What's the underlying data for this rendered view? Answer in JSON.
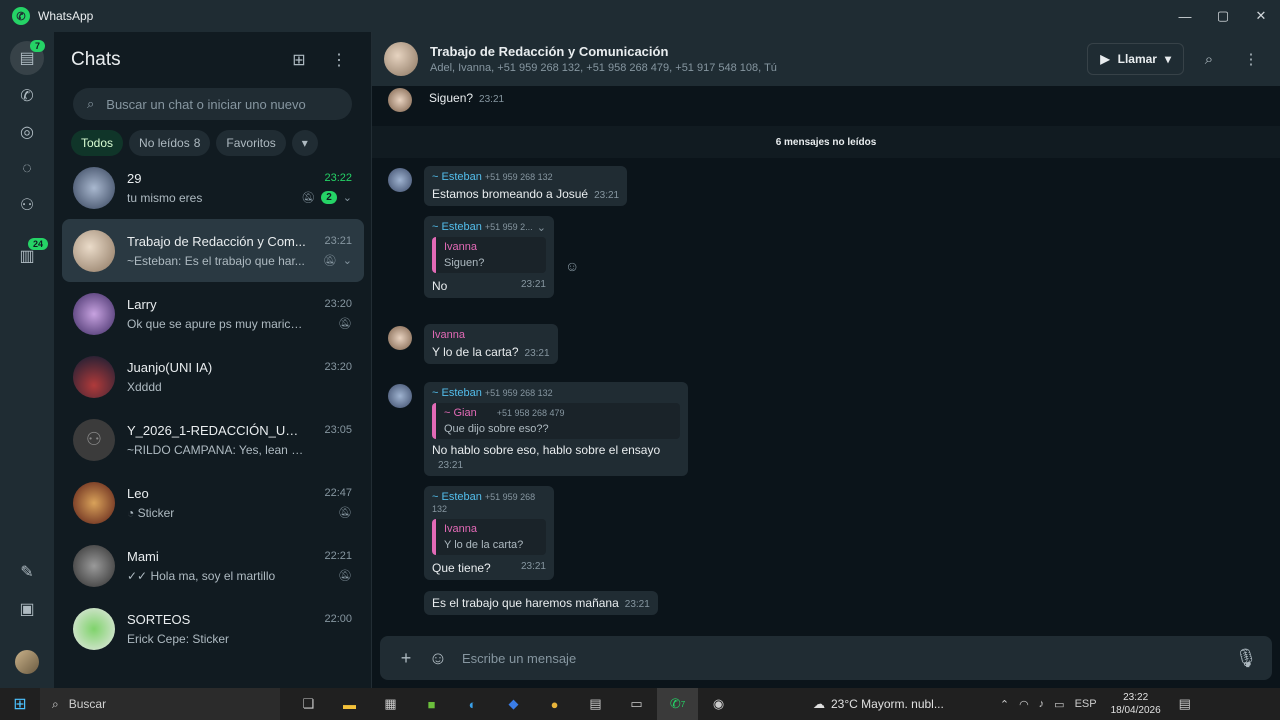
{
  "window": {
    "title": "WhatsApp",
    "controls": [
      "minimize",
      "maximize",
      "close"
    ]
  },
  "rail": {
    "chats_badge": "7",
    "status_badge": "24"
  },
  "sidebar": {
    "title": "Chats",
    "search_placeholder": "Buscar un chat o iniciar uno nuevo",
    "filters": [
      {
        "label": "Todos",
        "active": true
      },
      {
        "label": "No leídos",
        "count": "8"
      },
      {
        "label": "Favoritos"
      }
    ],
    "chats": [
      {
        "name": "29",
        "time": "23:22",
        "preview": "tu mismo eres",
        "unread": "2",
        "muted": true,
        "avatar_color": "#5a6f8a"
      },
      {
        "name": "Trabajo de Redacción y Com...",
        "time": "23:21",
        "preview": "~Esteban: Es el trabajo que har...",
        "muted": true,
        "selected": true,
        "avatar_color": "#c7b2a0"
      },
      {
        "name": "Larry",
        "time": "23:20",
        "preview": "Ok que se apure ps muy maricocin ...",
        "muted": true,
        "avatar_color": "#7a5fa8"
      },
      {
        "name": "Juanjo(UNI IA)",
        "time": "23:20",
        "preview": "Xdddd",
        "avatar_color": "#22344f"
      },
      {
        "name": "Y_2026_1-REDACCIÓN_UNI_...",
        "time": "23:05",
        "preview": "~RILDO CAMPANA: Yes, lean con aten...",
        "avatar_color": "#3b3b3b"
      },
      {
        "name": "Leo",
        "time": "22:47",
        "preview": "Sticker",
        "muted": true,
        "avatar_color": "#8c2f25"
      },
      {
        "name": "Mami",
        "time": "22:21",
        "preview": "Hola ma, soy el martillo",
        "muted": true,
        "avatar_color": "#555555"
      },
      {
        "name": "SORTEOS",
        "time": "22:00",
        "preview": "Erick Cepe: Sticker",
        "avatar_color": "#e6e6e6"
      }
    ]
  },
  "conversation": {
    "name": "Trabajo de Redacción y Comunicación",
    "members": "Adel, Ivanna, +51 959 268 132, +51 958 268 479, +51 917 548 108, Tú",
    "call_label": "Llamar",
    "unread_divider": "6 mensajes no leídos",
    "messages": {
      "m0": {
        "text": "Siguen?",
        "time": "23:21"
      },
      "m1": {
        "sender": "~ Esteban",
        "phone": "+51 959 268 132",
        "text": "Estamos bromeando a Josué",
        "time": "23:21"
      },
      "m2": {
        "sender": "~ Esteban",
        "phone": "+51 959 2...",
        "quote_name": "Ivanna",
        "quote_text": "Siguen?",
        "text": "No",
        "time": "23:21"
      },
      "m3": {
        "sender": "Ivanna",
        "text": "Y lo de la carta?",
        "time": "23:21"
      },
      "m4": {
        "sender": "~ Esteban",
        "phone": "+51 959 268 132",
        "quote_name": "~ Gian",
        "quote_phone": "+51 958 268 479",
        "quote_text": "Que dijo sobre eso??",
        "text": "No hablo sobre eso, hablo sobre el ensayo",
        "time": "23:21"
      },
      "m5": {
        "sender": "~ Esteban",
        "phone": "+51 959 268 132",
        "quote_name": "Ivanna",
        "quote_text": "Y lo de la carta?",
        "text": "Que tiene?",
        "time": "23:21"
      },
      "m6": {
        "text": "Es el trabajo que haremos mañana",
        "time": "23:21"
      }
    },
    "composer_placeholder": "Escribe un mensaje"
  },
  "taskbar": {
    "search_label": "Buscar",
    "whatsapp_badge": "7",
    "weather": "23°C  Mayorm. nubl...",
    "lang": "ESP",
    "time": "23:22",
    "date": "18/04/2026"
  }
}
